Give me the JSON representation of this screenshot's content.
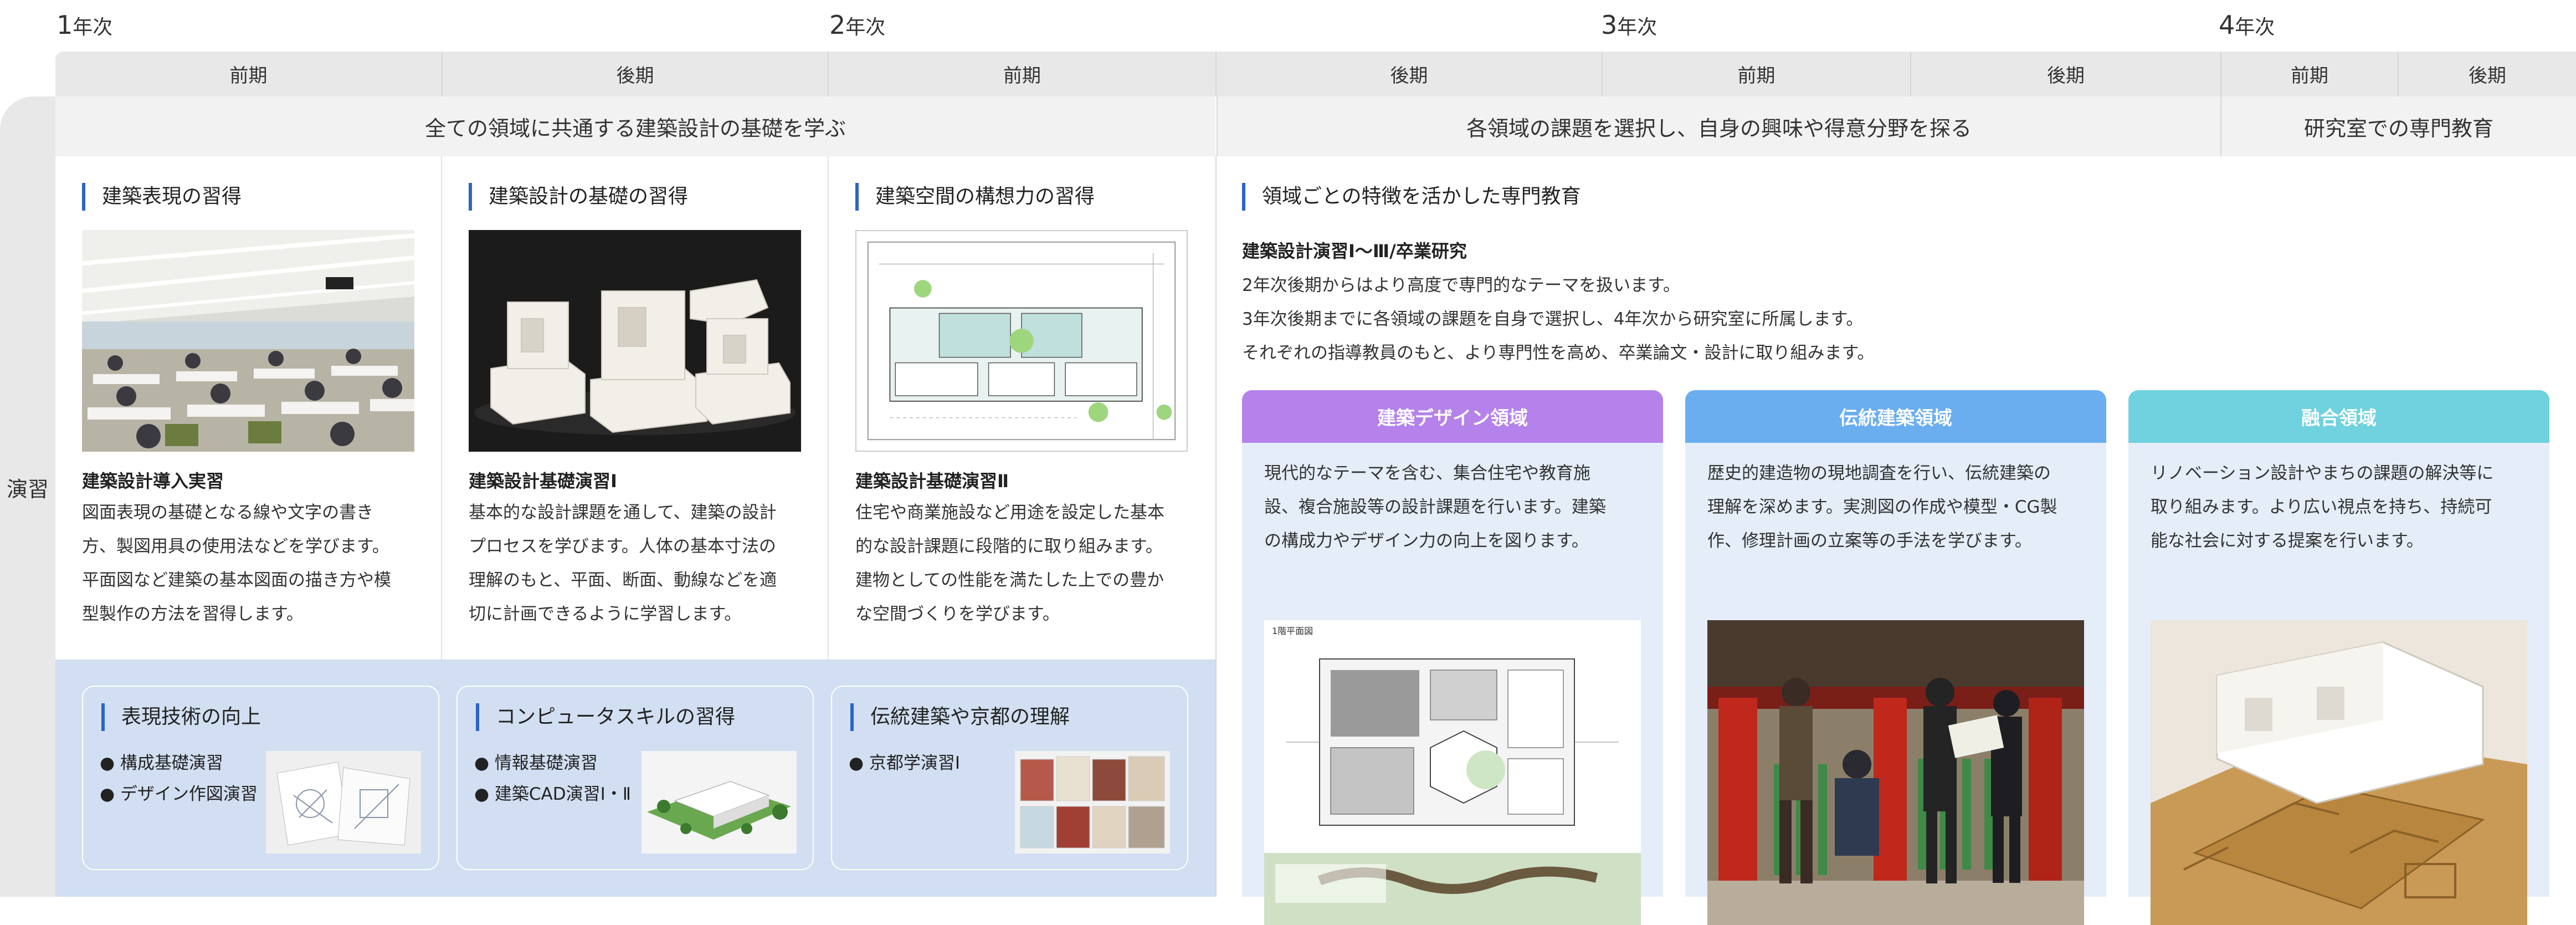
{
  "years": [
    {
      "num": "1",
      "suffix": "年次"
    },
    {
      "num": "2",
      "suffix": "年次"
    },
    {
      "num": "3",
      "suffix": "年次"
    },
    {
      "num": "4",
      "suffix": "年次"
    }
  ],
  "periods": [
    "前期",
    "後期",
    "前期",
    "後期",
    "前期",
    "後期",
    "前期",
    "後期"
  ],
  "bands": [
    "全ての領域に共通する建築設計の基礎を学ぶ",
    "各領域の課題を選択し、自身の興味や得意分野を探る",
    "研究室での専門教育"
  ],
  "side_label": "演習",
  "columns": [
    {
      "heading": "建築表現の習得",
      "title": "建築設計導入実習",
      "lines": [
        "図面表現の基礎となる線や文字の書き",
        "方、製図用具の使用法などを学びます。",
        "平面図など建築の基本図面の描き方や模",
        "型製作の方法を習得します。"
      ]
    },
    {
      "heading": "建築設計の基礎の習得",
      "title": "建築設計基礎演習Ⅰ",
      "lines": [
        "基本的な設計課題を通して、建築の設計",
        "プロセスを学びます。人体の基本寸法の",
        "理解のもと、平面、断面、動線などを適",
        "切に計画できるように学習します。"
      ]
    },
    {
      "heading": "建築空間の構想力の習得",
      "title": "建築設計基礎演習Ⅱ",
      "lines": [
        "住宅や商業施設など用途を設定した基本",
        "的な設計課題に段階的に取り組みます。",
        "建物としての性能を満たした上での豊か",
        "な空間づくりを学びます。"
      ]
    }
  ],
  "specialty": {
    "heading": "領域ごとの特徴を活かした専門教育",
    "subtitle": "建築設計演習Ⅰ～Ⅲ/卒業研究",
    "lines": [
      "2年次後期からはより高度で専門的なテーマを扱います。",
      "3年次後期までに各領域の課題を自身で選択し、4年次から研究室に所属します。",
      "それぞれの指導教員のもと、より専門性を高め、卒業論文・設計に取り組みます。"
    ]
  },
  "domains": [
    {
      "name": "建築デザイン領域",
      "color": "#b482ea",
      "lines": [
        "現代的なテーマを含む、集合住宅や教育施",
        "設、複合施設等の設計課題を行います。建築",
        "の構成力やデザイン力の向上を図ります。"
      ]
    },
    {
      "name": "伝統建築領域",
      "color": "#6aaef0",
      "lines": [
        "歴史的建造物の現地調査を行い、伝統建築の",
        "理解を深めます。実測図の作成や模型・CG製",
        "作、修理計画の立案等の手法を学びます。"
      ]
    },
    {
      "name": "融合領域",
      "color": "#6fd2de",
      "lines": [
        "リノベーション設計やまちの課題の解決等に",
        "取り組みます。より広い視点を持ち、持続可",
        "能な社会に対する提案を行います。"
      ]
    }
  ],
  "skills": [
    {
      "heading": "表現技術の向上",
      "items": [
        "構成基礎演習",
        "デザイン作図演習"
      ]
    },
    {
      "heading": "コンピュータスキルの習得",
      "items": [
        "情報基礎演習",
        "建築CAD演習Ⅰ・Ⅱ"
      ]
    },
    {
      "heading": "伝統建築や京都の理解",
      "items": [
        "京都学演習Ⅰ"
      ]
    }
  ],
  "plan_label": "1階平面図",
  "colors": {
    "accent": "#2a64c6",
    "bottom_bg": "#d2dff2",
    "domain_bg": "#e4edf8"
  }
}
